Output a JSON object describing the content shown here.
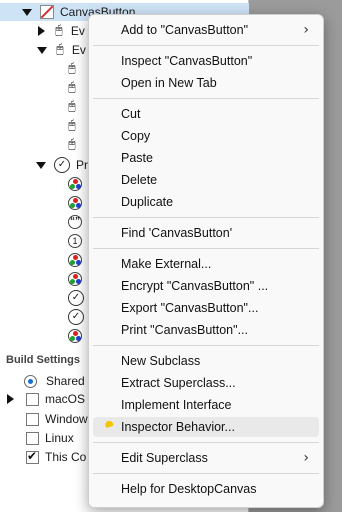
{
  "tree": {
    "root_label": "CanvasButton",
    "child1_label": "Ev",
    "child2_label": "Ev",
    "properties_label": "Pr"
  },
  "build_settings": {
    "title": "Build Settings",
    "items": [
      {
        "label": "Shared",
        "kind": "radio"
      },
      {
        "label": "macOS",
        "kind": "checkbox",
        "checked": false
      },
      {
        "label": "Window",
        "kind": "checkbox",
        "checked": false
      },
      {
        "label": "Linux",
        "kind": "checkbox",
        "checked": false
      },
      {
        "label": "This Co",
        "kind": "checkbox",
        "checked": true
      }
    ]
  },
  "menu": {
    "add_to": "Add to \"CanvasButton\"",
    "inspect": "Inspect \"CanvasButton\"",
    "open_new_tab": "Open in New Tab",
    "cut": "Cut",
    "copy": "Copy",
    "paste": "Paste",
    "delete": "Delete",
    "duplicate": "Duplicate",
    "find": "Find 'CanvasButton'",
    "make_external": "Make External...",
    "encrypt": "Encrypt \"CanvasButton\"  ...",
    "export": "Export \"CanvasButton\"...",
    "print": "Print \"CanvasButton\"...",
    "new_subclass": "New Subclass",
    "extract_superclass": "Extract Superclass...",
    "implement_interface": "Implement Interface",
    "inspector_behavior": "Inspector Behavior...",
    "edit_superclass": "Edit Superclass",
    "help": "Help for DesktopCanvas"
  }
}
